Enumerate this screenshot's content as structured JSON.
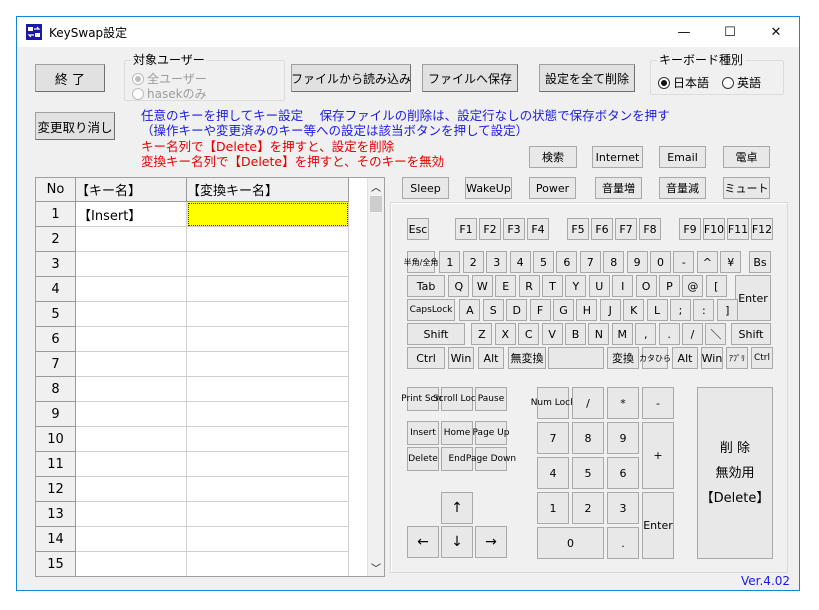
{
  "window": {
    "title": "KeySwap設定",
    "controls": {
      "minimize": "—",
      "maximize": "☐",
      "close": "✕"
    }
  },
  "top": {
    "exit_label": "終 了",
    "undo_label": "変更取り消し",
    "target_group": {
      "title": "対象ユーザー",
      "options": [
        {
          "label": "全ユーザー",
          "selected": true,
          "enabled": false
        },
        {
          "label": "hasekのみ",
          "selected": false,
          "enabled": false
        }
      ]
    },
    "load_label": "ファイルから読み込み",
    "save_label": "ファイルへ保存",
    "delete_all_label": "設定を全て削除",
    "kbtype_group": {
      "title": "キーボード種別",
      "options": [
        {
          "label": "日本語",
          "selected": true
        },
        {
          "label": "英語",
          "selected": false
        }
      ]
    }
  },
  "messages": {
    "line1": "任意のキーを押してキー設定　 保存ファイルの削除は、設定行なしの状態で保存ボタンを押す",
    "line2": "（操作キーや変更済みのキー等への設定は該当ボタンを押して設定）",
    "line3": "キー名列で【Delete】を押すと、設定を削除",
    "line4": "変換キー名列で【Delete】を押すと、そのキーを無効"
  },
  "special_keys": [
    "検索",
    "Internet",
    "Email",
    "電卓",
    "Sleep",
    "WakeUp",
    "Power",
    "音量増",
    "音量減",
    "ミュート"
  ],
  "grid": {
    "headers": [
      "No",
      "【キー名】",
      "【変換キー名】"
    ],
    "rows": [
      {
        "no": "1",
        "key": "【Insert】",
        "mapped": ""
      },
      {
        "no": "2",
        "key": "",
        "mapped": ""
      },
      {
        "no": "3",
        "key": "",
        "mapped": ""
      },
      {
        "no": "4",
        "key": "",
        "mapped": ""
      },
      {
        "no": "5",
        "key": "",
        "mapped": ""
      },
      {
        "no": "6",
        "key": "",
        "mapped": ""
      },
      {
        "no": "7",
        "key": "",
        "mapped": ""
      },
      {
        "no": "8",
        "key": "",
        "mapped": ""
      },
      {
        "no": "9",
        "key": "",
        "mapped": ""
      },
      {
        "no": "10",
        "key": "",
        "mapped": ""
      },
      {
        "no": "11",
        "key": "",
        "mapped": ""
      },
      {
        "no": "12",
        "key": "",
        "mapped": ""
      },
      {
        "no": "13",
        "key": "",
        "mapped": ""
      },
      {
        "no": "14",
        "key": "",
        "mapped": ""
      },
      {
        "no": "15",
        "key": "",
        "mapped": ""
      }
    ],
    "scroll_up": "︿",
    "scroll_down": "﹀",
    "selected_color": "#ffff00"
  },
  "keyboard": {
    "fn_row": [
      "Esc",
      "F1",
      "F2",
      "F3",
      "F4",
      "F5",
      "F6",
      "F7",
      "F8",
      "F9",
      "F10",
      "F11",
      "F12"
    ],
    "num_row": [
      "半角/全角",
      "1",
      "2",
      "3",
      "4",
      "5",
      "6",
      "7",
      "8",
      "9",
      "0",
      "-",
      "^",
      "¥",
      "Bs"
    ],
    "q_row": [
      "Tab",
      "Q",
      "W",
      "E",
      "R",
      "T",
      "Y",
      "U",
      "I",
      "O",
      "P",
      "@",
      "["
    ],
    "enter": "Enter",
    "a_row": [
      "CapsLock",
      "A",
      "S",
      "D",
      "F",
      "G",
      "H",
      "J",
      "K",
      "L",
      ";",
      ":",
      "]"
    ],
    "z_row": [
      "Shift",
      "Z",
      "X",
      "C",
      "V",
      "B",
      "N",
      "M",
      ",",
      ".",
      "/",
      "＼",
      "Shift"
    ],
    "bottom_row": [
      "Ctrl",
      "Win",
      "Alt",
      "無変換",
      "",
      "変換",
      "カタひら",
      "Alt",
      "Win",
      "ｱﾌﾟﾘ",
      "Ctrl"
    ],
    "nav": [
      "Print Scrn",
      "Scroll Lock",
      "Pause",
      "Insert",
      "Home",
      "Page Up",
      "Delete",
      "End",
      "Page Down"
    ],
    "arrows": [
      "↑",
      "←",
      "↓",
      "→"
    ],
    "numpad": [
      "Num Lock",
      "/",
      "*",
      "-",
      "7",
      "8",
      "9",
      "+",
      "4",
      "5",
      "6",
      "1",
      "2",
      "3",
      "Enter",
      "0",
      "."
    ],
    "delete_panel": {
      "line1": "削 除",
      "line2": "無効用",
      "line3": "【Delete】"
    }
  },
  "version": "Ver.4.02"
}
